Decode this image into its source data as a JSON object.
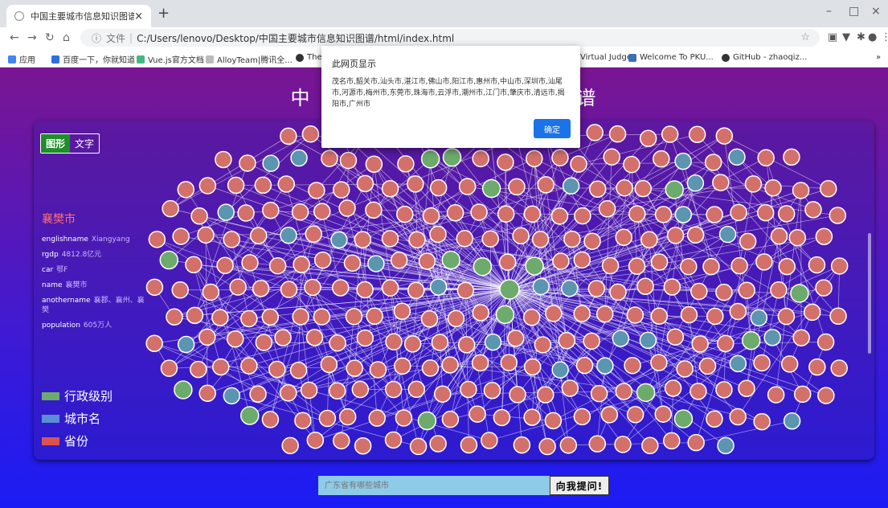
{
  "browser": {
    "tab_title": "中国主要城市信息知识图谱",
    "tab_close": "×",
    "new_tab": "+",
    "window_controls": [
      "–",
      "□",
      "×"
    ],
    "address_prefix": "文件",
    "address": "C:/Users/lenovo/Desktop/中国主要城市信息知识图谱/html/index.html",
    "bookmarks": [
      {
        "label": "应用",
        "color": "#4285f4"
      },
      {
        "label": "百度一下，你就知道",
        "color": "#2f6ee0"
      },
      {
        "label": "Vue.js官方文档",
        "color": "#41b883"
      },
      {
        "label": "AlloyTeam|腾讯全...",
        "color": "#bbbbbb"
      },
      {
        "label": "The",
        "color": "#333333"
      },
      {
        "label": "Virtual Judge",
        "color": "#ffffff"
      },
      {
        "label": "Welcome To PKU...",
        "color": "#3d6fb5"
      },
      {
        "label": "GitHub - zhaoqiz...",
        "color": "#333333"
      }
    ],
    "bookmarks_more": "»"
  },
  "page": {
    "title_left": "中",
    "title_right": "谱",
    "mode_tabs": [
      "图形",
      "文字"
    ],
    "selected_city": {
      "name": "襄樊市",
      "properties": [
        {
          "key": "englishname",
          "value": "Xiangyang"
        },
        {
          "key": "rgdp",
          "value": "4812.8亿元"
        },
        {
          "key": "car",
          "value": "鄂F"
        },
        {
          "key": "name",
          "value": "襄樊市"
        },
        {
          "key": "anothername",
          "value": "襄郡、襄州、襄樊"
        },
        {
          "key": "population",
          "value": "605万人"
        }
      ]
    },
    "legend": [
      {
        "label": "行政级别",
        "color": "#6cab6c"
      },
      {
        "label": "城市名",
        "color": "#5b8ed6"
      },
      {
        "label": "省份",
        "color": "#d9534f"
      }
    ],
    "question_placeholder": "广东省有哪些城市",
    "ask_button": "向我提问!"
  },
  "dialog": {
    "title": "此网页显示",
    "message": "茂名市,韶关市,汕头市,湛江市,佛山市,阳江市,惠州市,中山市,深圳市,汕尾市,河源市,梅州市,东莞市,珠海市,云浮市,潮州市,江门市,肇庆市,清远市,揭阳市,广州市",
    "ok_button": "确定"
  },
  "colors": {
    "node_province": "#d4706a",
    "node_city": "#5b95b0",
    "node_level": "#6cab6c",
    "edge": "#ffffff"
  }
}
